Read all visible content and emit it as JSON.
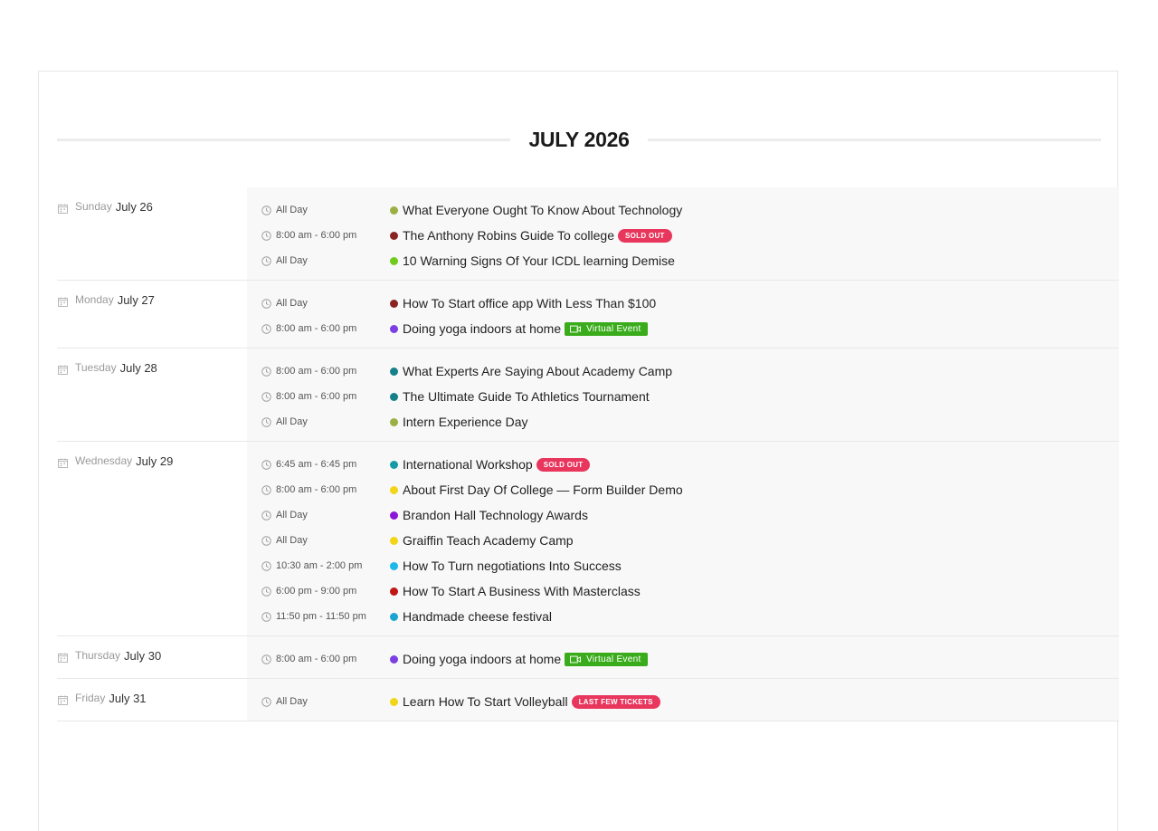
{
  "month_title": "JULY 2026",
  "days": [
    {
      "weekday": "Sunday",
      "date": "July 26",
      "events": [
        {
          "time": "All Day",
          "title": "What Everyone Ought To Know About Technology",
          "color": "#9bb044",
          "badge": ""
        },
        {
          "time": "8:00 am - 6:00 pm",
          "title": "The Anthony Robins Guide To college",
          "color": "#8a2424",
          "badge": "SOLD OUT"
        },
        {
          "time": "All Day",
          "title": "10 Warning Signs Of Your ICDL learning Demise",
          "color": "#6fcc1e",
          "badge": ""
        }
      ]
    },
    {
      "weekday": "Monday",
      "date": "July 27",
      "events": [
        {
          "time": "All Day",
          "title": "How To Start office app With Less Than $100",
          "color": "#8a2424",
          "badge": ""
        },
        {
          "time": "8:00 am - 6:00 pm",
          "title": "Doing yoga indoors at home",
          "color": "#7b3fe4",
          "virtual": "Virtual Event"
        }
      ]
    },
    {
      "weekday": "Tuesday",
      "date": "July 28",
      "events": [
        {
          "time": "8:00 am - 6:00 pm",
          "title": "What Experts Are Saying About Academy Camp",
          "color": "#157f8a",
          "badge": ""
        },
        {
          "time": "8:00 am - 6:00 pm",
          "title": "The Ultimate Guide To Athletics Tournament",
          "color": "#157f8a",
          "badge": ""
        },
        {
          "time": "All Day",
          "title": "Intern Experience Day",
          "color": "#9bb044",
          "badge": ""
        }
      ]
    },
    {
      "weekday": "Wednesday",
      "date": "July 29",
      "events": [
        {
          "time": "6:45 am - 6:45 pm",
          "title": "International Workshop",
          "color": "#159aa6",
          "badge": "SOLD OUT"
        },
        {
          "time": "8:00 am - 6:00 pm",
          "title": "About First Day Of College — Form Builder Demo",
          "color": "#f2d516",
          "badge": ""
        },
        {
          "time": "All Day",
          "title": "Brandon Hall Technology Awards",
          "color": "#8b16d9",
          "badge": ""
        },
        {
          "time": "All Day",
          "title": "Graiffin Teach Academy Camp",
          "color": "#f2d516",
          "badge": ""
        },
        {
          "time": "10:30 am - 2:00 pm",
          "title": "How To Turn negotiations Into Success",
          "color": "#1cb8e8",
          "badge": ""
        },
        {
          "time": "6:00 pm - 9:00 pm",
          "title": "How To Start A Business With Masterclass",
          "color": "#c01616",
          "badge": ""
        },
        {
          "time": "11:50 pm - 11:50 pm",
          "title": "Handmade cheese festival",
          "color": "#1aa4cf",
          "badge": ""
        }
      ]
    },
    {
      "weekday": "Thursday",
      "date": "July 30",
      "events": [
        {
          "time": "8:00 am - 6:00 pm",
          "title": "Doing yoga indoors at home",
          "color": "#7b3fe4",
          "virtual": "Virtual Event"
        }
      ]
    },
    {
      "weekday": "Friday",
      "date": "July 31",
      "events": [
        {
          "time": "All Day",
          "title": "Learn How To Start Volleyball",
          "color": "#f2d516",
          "badge": "LAST FEW TICKETS"
        }
      ]
    }
  ]
}
